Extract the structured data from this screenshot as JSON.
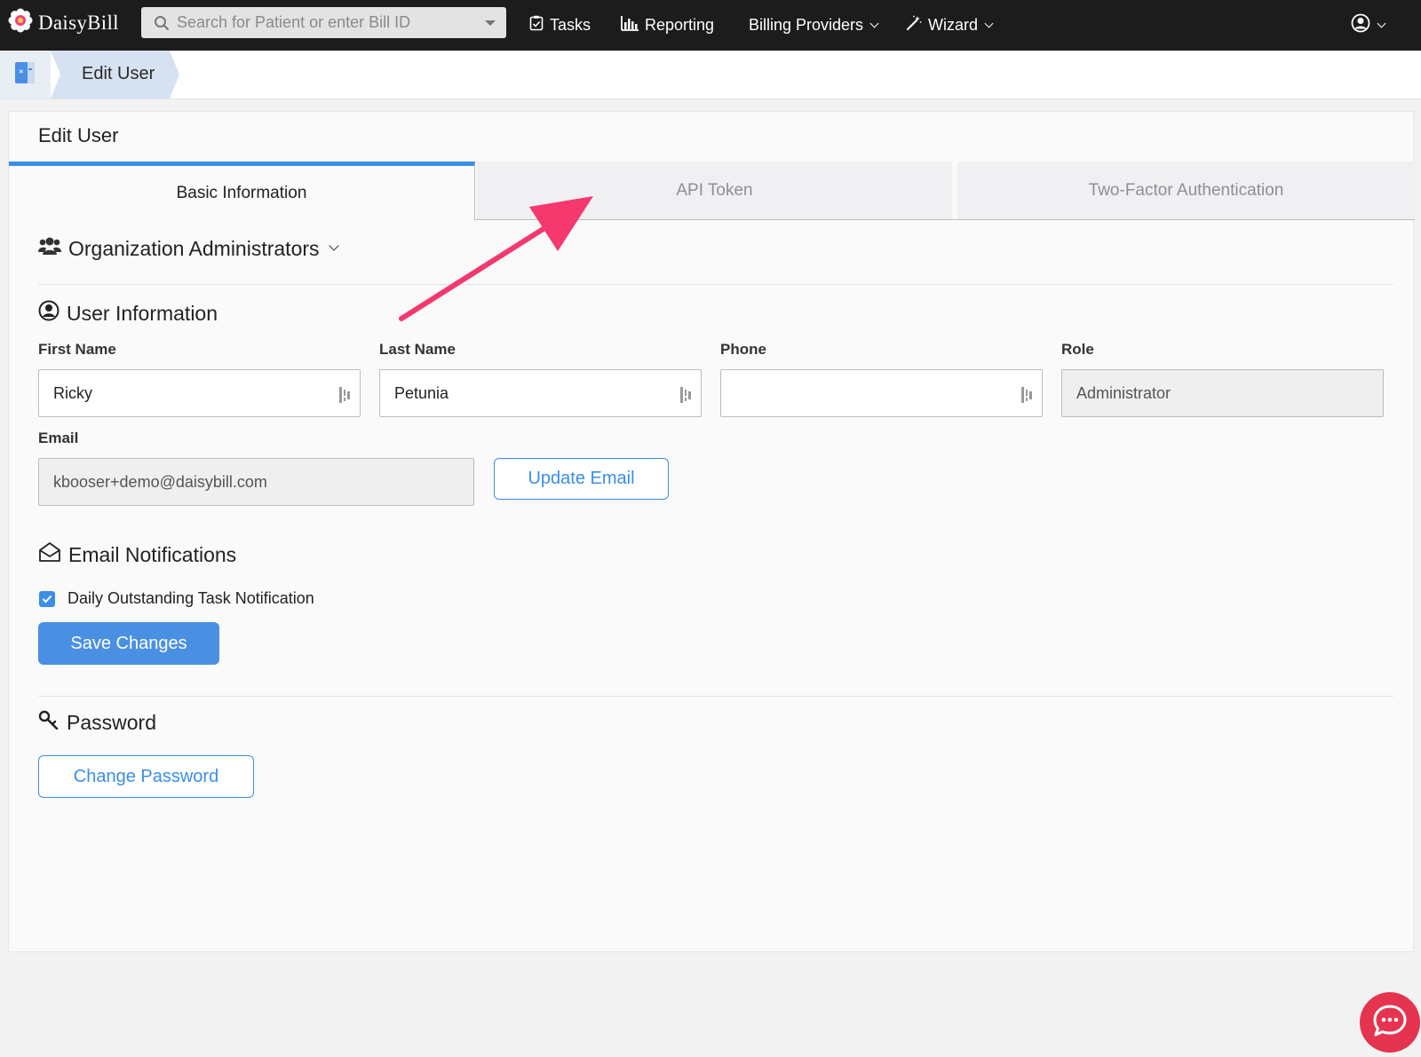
{
  "navbar": {
    "brand": "DaisyBill",
    "search_placeholder": "Search for Patient or enter Bill ID",
    "tasks": "Tasks",
    "reporting": "Reporting",
    "billing_providers": "Billing Providers",
    "wizard": "Wizard"
  },
  "breadcrumb": {
    "label": "Edit User"
  },
  "card": {
    "title": "Edit User"
  },
  "tabs": [
    {
      "label": "Basic Information",
      "active": true
    },
    {
      "label": "API Token",
      "active": false
    },
    {
      "label": "Two-Factor Authentication",
      "active": false
    }
  ],
  "sections": {
    "org_admins": "Organization Administrators",
    "user_info": "User Information",
    "email_notifications": "Email Notifications",
    "password": "Password"
  },
  "fields": {
    "first_name": {
      "label": "First Name",
      "value": "Ricky"
    },
    "last_name": {
      "label": "Last Name",
      "value": "Petunia"
    },
    "phone": {
      "label": "Phone",
      "value": ""
    },
    "role": {
      "label": "Role",
      "value": "Administrator"
    },
    "email": {
      "label": "Email",
      "value": "kbooser+demo@daisybill.com"
    }
  },
  "buttons": {
    "update_email": "Update Email",
    "save_changes": "Save Changes",
    "change_password": "Change Password"
  },
  "notifications": {
    "daily_task": {
      "label": "Daily Outstanding Task Notification",
      "checked": true
    }
  },
  "colors": {
    "accent": "#3b8ee8",
    "navbar_bg": "#1c1c1c",
    "annotation_arrow": "#f5386e",
    "chat_button": "#e5344f"
  }
}
